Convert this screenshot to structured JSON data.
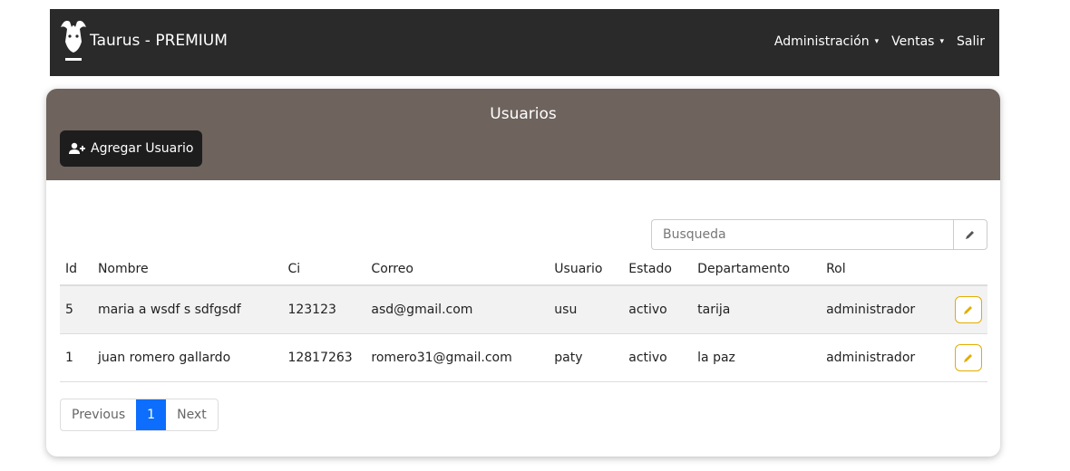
{
  "navbar": {
    "brand": "Taurus - PREMIUM",
    "menu": [
      {
        "label": "Administración",
        "has_caret": true
      },
      {
        "label": "Ventas",
        "has_caret": true
      },
      {
        "label": "Salir",
        "has_caret": false
      }
    ]
  },
  "card": {
    "title": "Usuarios",
    "add_button_label": "Agregar Usuario",
    "add_button_icon": "user-plus-icon"
  },
  "search": {
    "placeholder": "Busqueda",
    "button_icon": "pencil-icon"
  },
  "table": {
    "headers": [
      "Id",
      "Nombre",
      "Ci",
      "Correo",
      "Usuario",
      "Estado",
      "Departamento",
      "Rol",
      ""
    ],
    "rows": [
      [
        "5",
        "maria a wsdf s sdfgsdf",
        "123123",
        "asd@gmail.com",
        "usu",
        "activo",
        "tarija",
        "administrador"
      ],
      [
        "1",
        "juan romero gallardo",
        "12817263",
        "romero31@gmail.com",
        "paty",
        "activo",
        "la paz",
        "administrador"
      ]
    ]
  },
  "pagination": {
    "previous": "Previous",
    "current": "1",
    "next": "Next"
  },
  "colors": {
    "navbar_bg": "#2a2a2a",
    "card_header_bg": "#6e635d",
    "primary": "#0d6efd",
    "warning": "#e2ad00"
  }
}
